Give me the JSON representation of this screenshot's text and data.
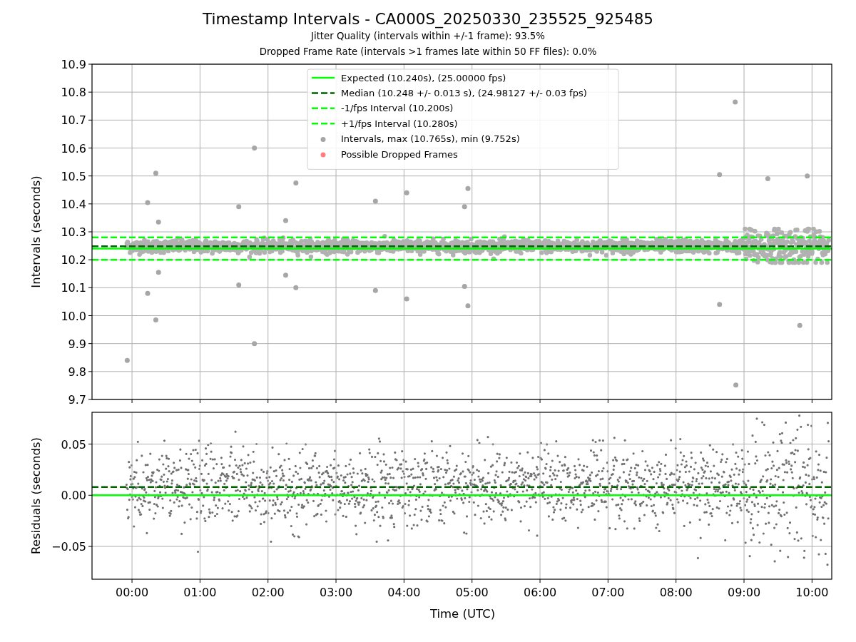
{
  "figure": {
    "title": "Timestamp Intervals - CA000S_20250330_235525_925485",
    "subtitles": [
      "Jitter Quality (intervals within +/-1 frame): 93.5%",
      "Dropped Frame Rate (intervals >1 frames late within 50 FF files): 0.0%"
    ]
  },
  "plots": [
    {
      "chart_data": {
        "type": "scatter",
        "ylabel": "Intervals (seconds)",
        "xlim": [
          -0.588,
          10.29
        ],
        "ylim": [
          9.7,
          10.9
        ],
        "grid": true,
        "legend": "upper center",
        "yticks": [
          {
            "value": 9.7,
            "label": "9.7"
          },
          {
            "value": 9.8,
            "label": "9.8"
          },
          {
            "value": 9.9,
            "label": "9.9"
          },
          {
            "value": 10.0,
            "label": "10.0"
          },
          {
            "value": 10.1,
            "label": "10.1"
          },
          {
            "value": 10.2,
            "label": "10.2"
          },
          {
            "value": 10.3,
            "label": "10.3"
          },
          {
            "value": 10.4,
            "label": "10.4"
          },
          {
            "value": 10.5,
            "label": "10.5"
          },
          {
            "value": 10.6,
            "label": "10.6"
          },
          {
            "value": 10.7,
            "label": "10.7"
          },
          {
            "value": 10.8,
            "label": "10.8"
          },
          {
            "value": 10.9,
            "label": "10.9"
          }
        ],
        "series": [
          {
            "name": "Expected (10.240s), (25.00000 fps)",
            "type": "line",
            "line_style": "solid",
            "color": "#00ff00",
            "x": [
              -0.588,
              10.29
            ],
            "values": [
              10.24,
              10.24
            ]
          },
          {
            "name": "Median (10.248 +/- 0.013 s), (24.98127 +/- 0.03 fps)",
            "type": "line",
            "line_style": "dashed",
            "color": "#006400",
            "x": [
              -0.588,
              10.29
            ],
            "values": [
              10.248,
              10.248
            ]
          },
          {
            "name": "-1/fps Interval (10.200s)",
            "type": "line",
            "line_style": "dashed",
            "color": "#00ff00",
            "x": [
              -0.588,
              10.29
            ],
            "values": [
              10.2,
              10.2
            ]
          },
          {
            "name": "+1/fps Interval (10.280s)",
            "type": "line",
            "line_style": "dashed",
            "color": "#00ff00",
            "x": [
              -0.588,
              10.29
            ],
            "values": [
              10.28,
              10.28
            ]
          },
          {
            "name": "Intervals, max (10.765s), min (9.752s)",
            "type": "scatter",
            "color": "#a6a6a6",
            "x": [
              -0.07,
              0.23,
              0.23,
              0.35,
              0.35,
              0.39,
              0.39,
              1.57,
              1.57,
              1.8,
              1.8,
              2.26,
              2.26,
              2.41,
              2.41,
              3.58,
              3.58,
              4.04,
              4.04,
              4.89,
              4.89,
              4.94,
              4.94,
              8.64,
              8.64,
              8.87,
              8.88,
              9.35,
              9.82,
              9.93
            ],
            "values": [
              9.84,
              10.405,
              10.08,
              10.51,
              9.985,
              10.335,
              10.155,
              10.39,
              10.11,
              10.6,
              9.9,
              10.34,
              10.145,
              10.475,
              10.1,
              10.41,
              10.09,
              10.44,
              10.06,
              10.39,
              10.105,
              10.455,
              10.035,
              10.505,
              10.04,
              10.765,
              9.752,
              10.49,
              9.965,
              10.5
            ]
          },
          {
            "name": "Possible Dropped Frames",
            "type": "scatter",
            "color": "#ff7f7f"
          }
        ]
      }
    },
    {
      "chart_data": {
        "type": "scatter",
        "xlabel": "Time (UTC)",
        "ylabel": "Residuals (seconds)",
        "xlim": [
          -0.588,
          10.29
        ],
        "ylim": [
          -0.082,
          0.081
        ],
        "grid": true,
        "xticks": [
          {
            "value": 0,
            "label": "00:00"
          },
          {
            "value": 1,
            "label": "01:00"
          },
          {
            "value": 2,
            "label": "02:00"
          },
          {
            "value": 3,
            "label": "03:00"
          },
          {
            "value": 4,
            "label": "04:00"
          },
          {
            "value": 5,
            "label": "05:00"
          },
          {
            "value": 6,
            "label": "06:00"
          },
          {
            "value": 7,
            "label": "07:00"
          },
          {
            "value": 8,
            "label": "08:00"
          },
          {
            "value": 9,
            "label": "09:00"
          },
          {
            "value": 10,
            "label": "10:00"
          }
        ],
        "yticks": [
          {
            "value": -0.05,
            "label": "−0.05"
          },
          {
            "value": 0,
            "label": "0.00"
          },
          {
            "value": 0.05,
            "label": "0.05"
          }
        ],
        "series": [
          {
            "type": "line",
            "line_style": "solid",
            "color": "#00ff00",
            "x": [
              -0.588,
              10.29
            ],
            "values": [
              0,
              0
            ]
          },
          {
            "type": "line",
            "line_style": "dashed",
            "color": "#006400",
            "x": [
              -0.588,
              10.29
            ],
            "values": [
              0.008,
              0.008
            ]
          }
        ]
      }
    }
  ]
}
